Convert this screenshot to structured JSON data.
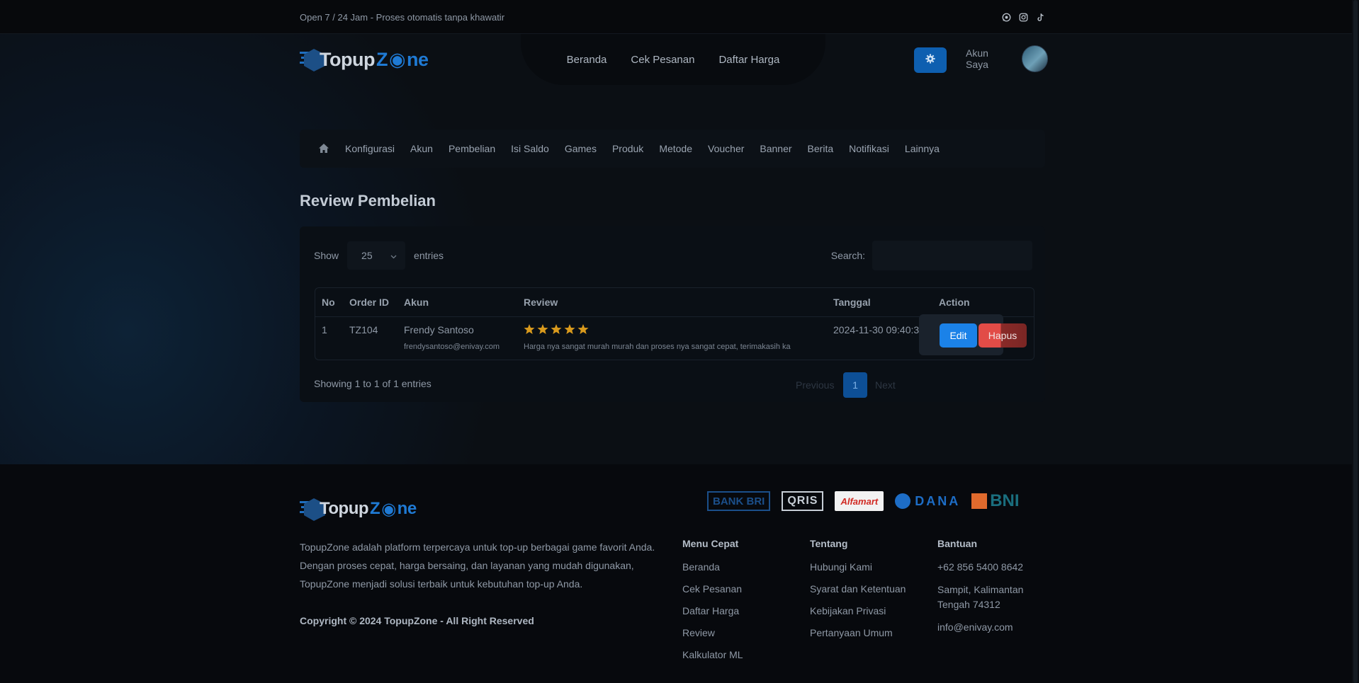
{
  "topbar": {
    "note": "Open 7 / 24 Jam - Proses otomatis tanpa khawatir",
    "socials": [
      "whatsapp-icon",
      "instagram-icon",
      "tiktok-icon"
    ]
  },
  "header": {
    "logo_part1": "Topup",
    "logo_part2": "Z",
    "logo_part3": "ne",
    "nav": [
      "Beranda",
      "Cek Pesanan",
      "Daftar Harga"
    ],
    "account_label": "Akun Saya"
  },
  "admin_nav": {
    "items": [
      "Konfigurasi",
      "Akun",
      "Pembelian",
      "Isi Saldo",
      "Games",
      "Produk",
      "Metode",
      "Voucher",
      "Banner",
      "Berita",
      "Notifikasi",
      "Lainnya"
    ]
  },
  "page": {
    "title": "Review Pembelian"
  },
  "table_controls": {
    "show_label": "Show",
    "page_size": "25",
    "entries_label": "entries",
    "search_label": "Search:",
    "search_value": ""
  },
  "table": {
    "headers": [
      "No",
      "Order ID",
      "Akun",
      "Review",
      "Tanggal",
      "Action"
    ],
    "rows": [
      {
        "no": "1",
        "order_id": "TZ104",
        "name": "Frendy Santoso",
        "email": "frendysantoso@enivay.com",
        "rating": 5,
        "review": "Harga nya sangat murah murah dan proses nya sangat cepat, terimakasih ka",
        "date": "2024-11-30 09:40:30",
        "edit_label": "Edit",
        "delete_label": "Hapus"
      }
    ]
  },
  "pagination": {
    "info": "Showing 1 to 1 of 1 entries",
    "previous": "Previous",
    "current": "1",
    "next": "Next"
  },
  "footer": {
    "description": "TopupZone adalah platform terpercaya untuk top-up berbagai game favorit Anda. Dengan proses cepat, harga bersaing, dan layanan yang mudah digunakan, TopupZone menjadi solusi terbaik untuk kebutuhan top-up Anda.",
    "copyright": "Copyright © 2024 TopupZone - All Right Reserved",
    "payments": [
      "BANK BRI",
      "QRIS",
      "Alfamart",
      "DANA",
      "BNI"
    ],
    "menu_cepat": {
      "title": "Menu Cepat",
      "items": [
        "Beranda",
        "Cek Pesanan",
        "Daftar Harga",
        "Review",
        "Kalkulator ML"
      ]
    },
    "tentang": {
      "title": "Tentang",
      "items": [
        "Hubungi Kami",
        "Syarat dan Ketentuan",
        "Kebijakan Privasi",
        "Pertanyaan Umum"
      ]
    },
    "bantuan": {
      "title": "Bantuan",
      "phone": "+62 856 5400 8642",
      "address": "Sampit, Kalimantan Tengah 74312",
      "email": "info@enivay.com"
    }
  },
  "colors": {
    "accent": "#1b82e8",
    "danger": "#e24c47",
    "star": "#d99a1d"
  }
}
